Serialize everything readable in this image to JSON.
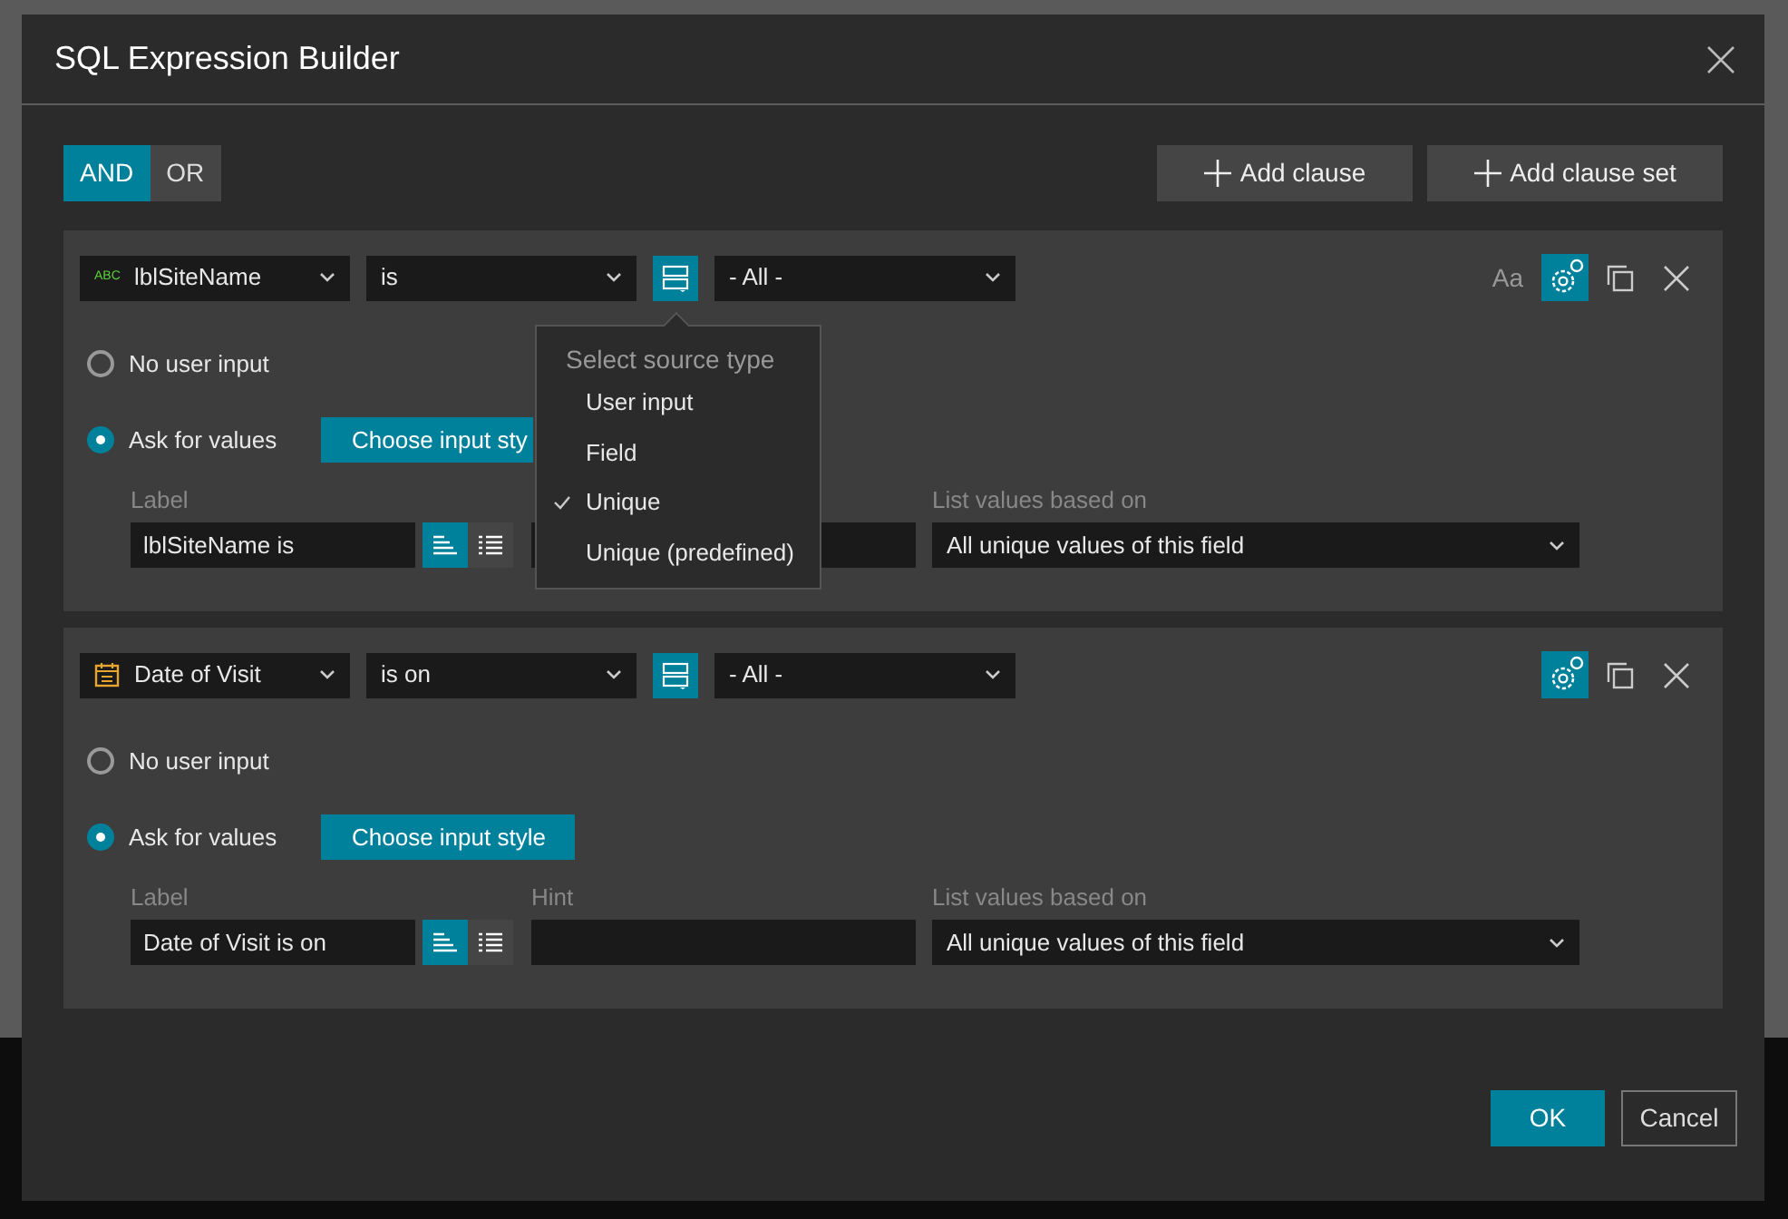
{
  "dialog": {
    "title": "SQL Expression Builder"
  },
  "logic": [
    {
      "label": "AND",
      "selected": true
    },
    {
      "label": "OR",
      "selected": false
    }
  ],
  "toolbar_buttons": [
    "Add clause",
    "Add clause set"
  ],
  "clauses": [
    {
      "field": {
        "kind": "text",
        "badge": "ABC",
        "name": "lblSiteName"
      },
      "operator": "is",
      "value": "- All -",
      "case_label": "Aa",
      "options": [
        {
          "label": "No user input",
          "selected": false
        },
        {
          "label": "Ask for values",
          "selected": true
        }
      ],
      "style_button": "Choose input sty",
      "label_heading": "Label",
      "label_value": "lblSiteName is",
      "display_modes": [
        {
          "selected": true
        },
        {
          "selected": false
        }
      ],
      "list_heading": "List values based on",
      "list_value": "All unique values of this field",
      "source_menu": {
        "title": "Select source type",
        "options": [
          {
            "label": "User input",
            "checked": false
          },
          {
            "label": "Field",
            "checked": false
          },
          {
            "label": "Unique",
            "checked": true
          },
          {
            "label": "Unique (predefined)",
            "checked": false
          }
        ]
      }
    },
    {
      "field": {
        "kind": "date",
        "name": "Date of Visit"
      },
      "operator": "is on",
      "value": "- All -",
      "options": [
        {
          "label": "No user input",
          "selected": false
        },
        {
          "label": "Ask for values",
          "selected": true
        }
      ],
      "style_button": "Choose input style",
      "label_heading": "Label",
      "label_value": "Date of Visit is on",
      "display_modes": [
        {
          "selected": true
        },
        {
          "selected": false
        }
      ],
      "hint_heading": "Hint",
      "list_heading": "List values based on",
      "list_value": "All unique values of this field"
    }
  ],
  "footer_buttons": [
    {
      "label": "OK",
      "kind": "primary"
    },
    {
      "label": "Cancel",
      "kind": "secondary"
    }
  ]
}
